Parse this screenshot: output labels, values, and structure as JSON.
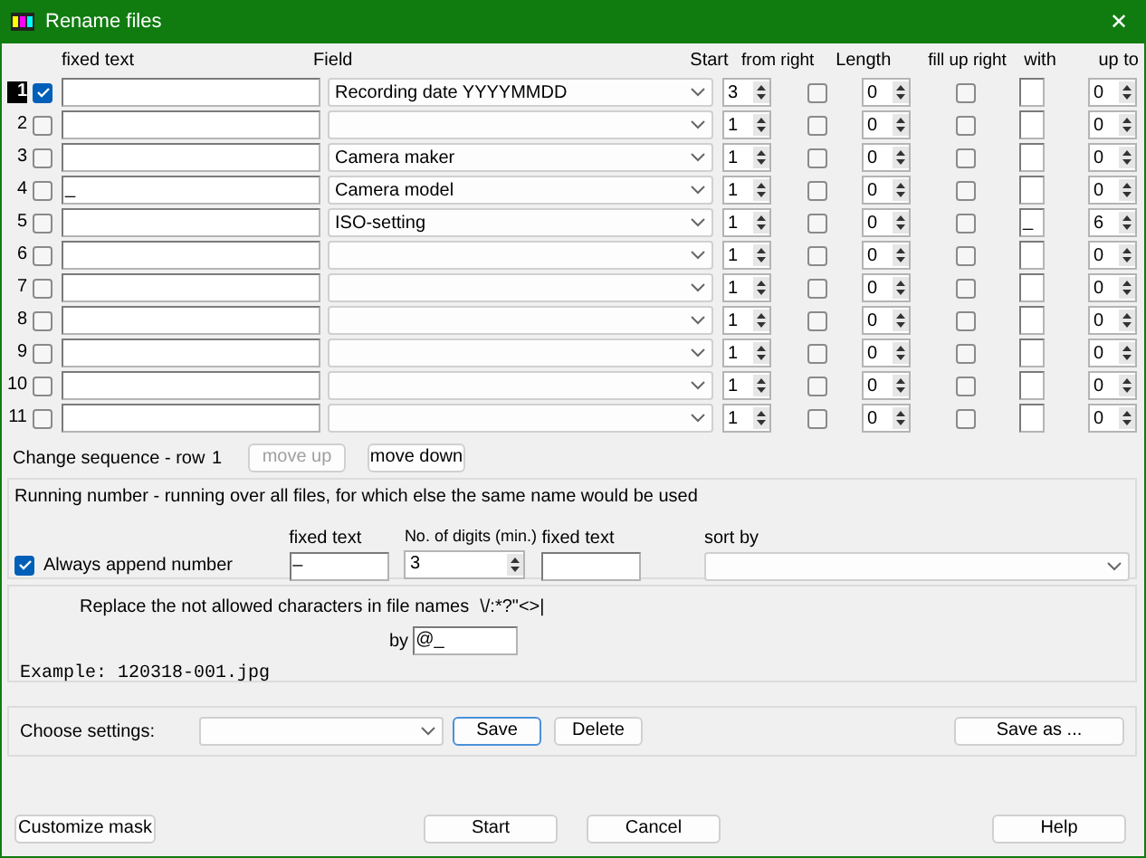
{
  "window": {
    "title": "Rename files",
    "close": "✕"
  },
  "columns": [
    "fixed text",
    "Field",
    "Start",
    "from right",
    "Length",
    "fill up right",
    "with",
    "up to"
  ],
  "rows": [
    {
      "number": "1",
      "selected": true,
      "checked": true,
      "fixed_text": "",
      "field": "Recording date YYYYMMDD",
      "start": "3",
      "from_right": false,
      "length": "0",
      "fill_up_right": false,
      "with": "",
      "up_to": "0"
    },
    {
      "number": "2",
      "selected": false,
      "checked": false,
      "fixed_text": "",
      "field": "",
      "start": "1",
      "from_right": false,
      "length": "0",
      "fill_up_right": false,
      "with": "",
      "up_to": "0"
    },
    {
      "number": "3",
      "selected": false,
      "checked": false,
      "fixed_text": "",
      "field": "Camera maker",
      "start": "1",
      "from_right": false,
      "length": "0",
      "fill_up_right": false,
      "with": "",
      "up_to": "0"
    },
    {
      "number": "4",
      "selected": false,
      "checked": false,
      "fixed_text": "_",
      "field": "Camera model",
      "start": "1",
      "from_right": false,
      "length": "0",
      "fill_up_right": false,
      "with": "",
      "up_to": "0"
    },
    {
      "number": "5",
      "selected": false,
      "checked": false,
      "fixed_text": "",
      "field": "ISO-setting",
      "start": "1",
      "from_right": false,
      "length": "0",
      "fill_up_right": false,
      "with": "_",
      "up_to": "6"
    },
    {
      "number": "6",
      "selected": false,
      "checked": false,
      "fixed_text": "",
      "field": "",
      "start": "1",
      "from_right": false,
      "length": "0",
      "fill_up_right": false,
      "with": "",
      "up_to": "0"
    },
    {
      "number": "7",
      "selected": false,
      "checked": false,
      "fixed_text": "",
      "field": "",
      "start": "1",
      "from_right": false,
      "length": "0",
      "fill_up_right": false,
      "with": "",
      "up_to": "0"
    },
    {
      "number": "8",
      "selected": false,
      "checked": false,
      "fixed_text": "",
      "field": "",
      "start": "1",
      "from_right": false,
      "length": "0",
      "fill_up_right": false,
      "with": "",
      "up_to": "0"
    },
    {
      "number": "9",
      "selected": false,
      "checked": false,
      "fixed_text": "",
      "field": "",
      "start": "1",
      "from_right": false,
      "length": "0",
      "fill_up_right": false,
      "with": "",
      "up_to": "0"
    },
    {
      "number": "10",
      "selected": false,
      "checked": false,
      "fixed_text": "",
      "field": "",
      "start": "1",
      "from_right": false,
      "length": "0",
      "fill_up_right": false,
      "with": "",
      "up_to": "0"
    },
    {
      "number": "11",
      "selected": false,
      "checked": false,
      "fixed_text": "",
      "field": "",
      "start": "1",
      "from_right": false,
      "length": "0",
      "fill_up_right": false,
      "with": "",
      "up_to": "0"
    }
  ],
  "sequence": {
    "label": "Change sequence - row",
    "row": "1",
    "buttons": [
      {
        "label": "move up",
        "disabled": true
      },
      {
        "label": "move down",
        "disabled": false
      }
    ]
  },
  "running_number": {
    "title": "Running number - running over all files, for which else the same name would be used",
    "always_append": {
      "label": "Always append number",
      "checked": true
    },
    "fixed_text_label": "fixed text",
    "fixed_text": "–",
    "digits_label": "No. of digits (min.)",
    "digits": "3",
    "suffix_label": "fixed text",
    "sort_label": "sort by"
  },
  "replace": {
    "label": "Replace the not allowed characters in file names",
    "chars": "\\/:*?\"<>|",
    "by_label": "by",
    "by": "@_",
    "example": "Example: 120318-001.jpg"
  },
  "settings": {
    "label": "Choose settings:",
    "buttons": [
      "Save",
      "Delete"
    ],
    "save_as": "Save as ..."
  },
  "footer": {
    "customize": "Customize mask",
    "start": "Start",
    "cancel": "Cancel",
    "help": "Help"
  }
}
